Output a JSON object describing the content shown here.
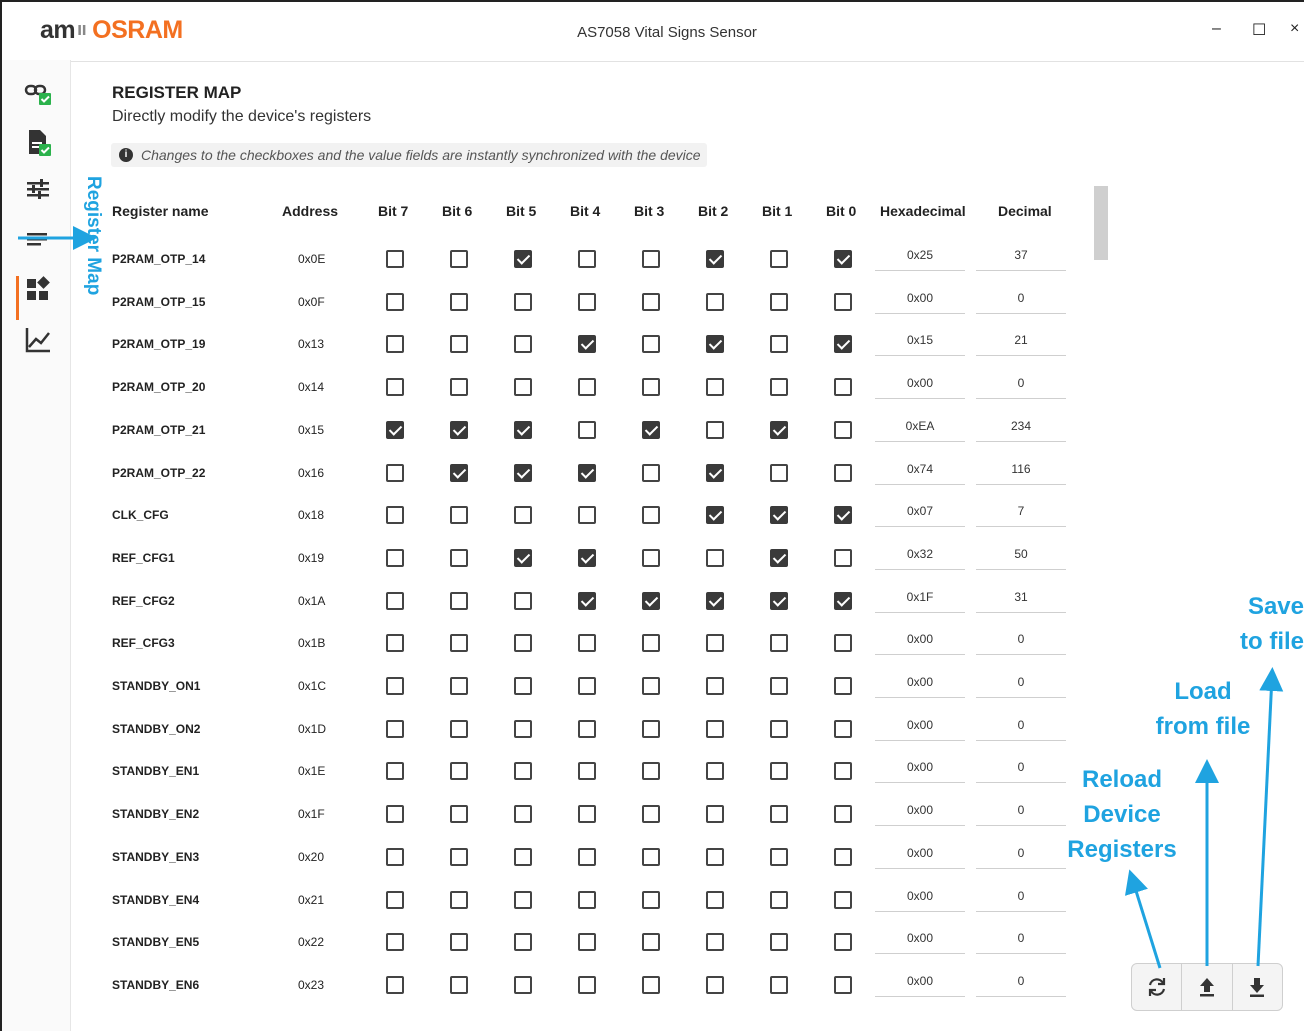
{
  "window": {
    "logo_am": "am",
    "logo_sep": "ıı",
    "logo_brand": "OSRAM",
    "title": "AS7058 Vital Signs Sensor",
    "minimize": "–",
    "maximize": "☐",
    "close": "×"
  },
  "sidebar": {
    "items": [
      {
        "name": "connection-icon",
        "status": "ok"
      },
      {
        "name": "document-icon",
        "status": "ok"
      },
      {
        "name": "settings-sliders-icon"
      },
      {
        "name": "register-map-icon",
        "active": true
      },
      {
        "name": "plugins-icon"
      },
      {
        "name": "chart-icon"
      }
    ],
    "help": "?"
  },
  "header": {
    "title": "REGISTER MAP",
    "subtitle": "Directly modify the device's registers",
    "info": "Changes to the checkboxes and the value fields are instantly synchronized with the device",
    "info_icon": "i"
  },
  "table": {
    "headers": {
      "name": "Register name",
      "address": "Address",
      "bit7": "Bit 7",
      "bit6": "Bit 6",
      "bit5": "Bit 5",
      "bit4": "Bit 4",
      "bit3": "Bit 3",
      "bit2": "Bit 2",
      "bit1": "Bit 1",
      "bit0": "Bit 0",
      "hex": "Hexadecimal",
      "dec": "Decimal"
    },
    "rows": [
      {
        "name": "P2RAM_OTP_14",
        "address": "0x0E",
        "bits": [
          0,
          0,
          1,
          0,
          0,
          1,
          0,
          1
        ],
        "hex": "0x25",
        "dec": "37"
      },
      {
        "name": "P2RAM_OTP_15",
        "address": "0x0F",
        "bits": [
          0,
          0,
          0,
          0,
          0,
          0,
          0,
          0
        ],
        "hex": "0x00",
        "dec": "0"
      },
      {
        "name": "P2RAM_OTP_19",
        "address": "0x13",
        "bits": [
          0,
          0,
          0,
          1,
          0,
          1,
          0,
          1
        ],
        "hex": "0x15",
        "dec": "21"
      },
      {
        "name": "P2RAM_OTP_20",
        "address": "0x14",
        "bits": [
          0,
          0,
          0,
          0,
          0,
          0,
          0,
          0
        ],
        "hex": "0x00",
        "dec": "0"
      },
      {
        "name": "P2RAM_OTP_21",
        "address": "0x15",
        "bits": [
          1,
          1,
          1,
          0,
          1,
          0,
          1,
          0
        ],
        "hex": "0xEA",
        "dec": "234"
      },
      {
        "name": "P2RAM_OTP_22",
        "address": "0x16",
        "bits": [
          0,
          1,
          1,
          1,
          0,
          1,
          0,
          0
        ],
        "hex": "0x74",
        "dec": "116"
      },
      {
        "name": "CLK_CFG",
        "address": "0x18",
        "bits": [
          0,
          0,
          0,
          0,
          0,
          1,
          1,
          1
        ],
        "hex": "0x07",
        "dec": "7"
      },
      {
        "name": "REF_CFG1",
        "address": "0x19",
        "bits": [
          0,
          0,
          1,
          1,
          0,
          0,
          1,
          0
        ],
        "hex": "0x32",
        "dec": "50"
      },
      {
        "name": "REF_CFG2",
        "address": "0x1A",
        "bits": [
          0,
          0,
          0,
          1,
          1,
          1,
          1,
          1
        ],
        "hex": "0x1F",
        "dec": "31"
      },
      {
        "name": "REF_CFG3",
        "address": "0x1B",
        "bits": [
          0,
          0,
          0,
          0,
          0,
          0,
          0,
          0
        ],
        "hex": "0x00",
        "dec": "0"
      },
      {
        "name": "STANDBY_ON1",
        "address": "0x1C",
        "bits": [
          0,
          0,
          0,
          0,
          0,
          0,
          0,
          0
        ],
        "hex": "0x00",
        "dec": "0"
      },
      {
        "name": "STANDBY_ON2",
        "address": "0x1D",
        "bits": [
          0,
          0,
          0,
          0,
          0,
          0,
          0,
          0
        ],
        "hex": "0x00",
        "dec": "0"
      },
      {
        "name": "STANDBY_EN1",
        "address": "0x1E",
        "bits": [
          0,
          0,
          0,
          0,
          0,
          0,
          0,
          0
        ],
        "hex": "0x00",
        "dec": "0"
      },
      {
        "name": "STANDBY_EN2",
        "address": "0x1F",
        "bits": [
          0,
          0,
          0,
          0,
          0,
          0,
          0,
          0
        ],
        "hex": "0x00",
        "dec": "0"
      },
      {
        "name": "STANDBY_EN3",
        "address": "0x20",
        "bits": [
          0,
          0,
          0,
          0,
          0,
          0,
          0,
          0
        ],
        "hex": "0x00",
        "dec": "0"
      },
      {
        "name": "STANDBY_EN4",
        "address": "0x21",
        "bits": [
          0,
          0,
          0,
          0,
          0,
          0,
          0,
          0
        ],
        "hex": "0x00",
        "dec": "0"
      },
      {
        "name": "STANDBY_EN5",
        "address": "0x22",
        "bits": [
          0,
          0,
          0,
          0,
          0,
          0,
          0,
          0
        ],
        "hex": "0x00",
        "dec": "0"
      },
      {
        "name": "STANDBY_EN6",
        "address": "0x23",
        "bits": [
          0,
          0,
          0,
          0,
          0,
          0,
          0,
          0
        ],
        "hex": "0x00",
        "dec": "0"
      }
    ]
  },
  "actions": [
    {
      "name": "reload-device-registers-button",
      "icon": "refresh-icon"
    },
    {
      "name": "load-from-file-button",
      "icon": "upload-icon"
    },
    {
      "name": "save-to-file-button",
      "icon": "download-icon"
    }
  ],
  "annotations": {
    "register_map": "Register Map",
    "reload_line1": "Reload",
    "reload_line2": "Device",
    "reload_line3": "Registers",
    "load_line1": "Load",
    "load_line2": "from file",
    "save_line1": "Save",
    "save_line2": "to file"
  },
  "colors": {
    "brand": "#f37021",
    "annotation": "#1fa3e0",
    "status_ok": "#2bb24c",
    "checkbox_on": "#3a3a3a"
  }
}
